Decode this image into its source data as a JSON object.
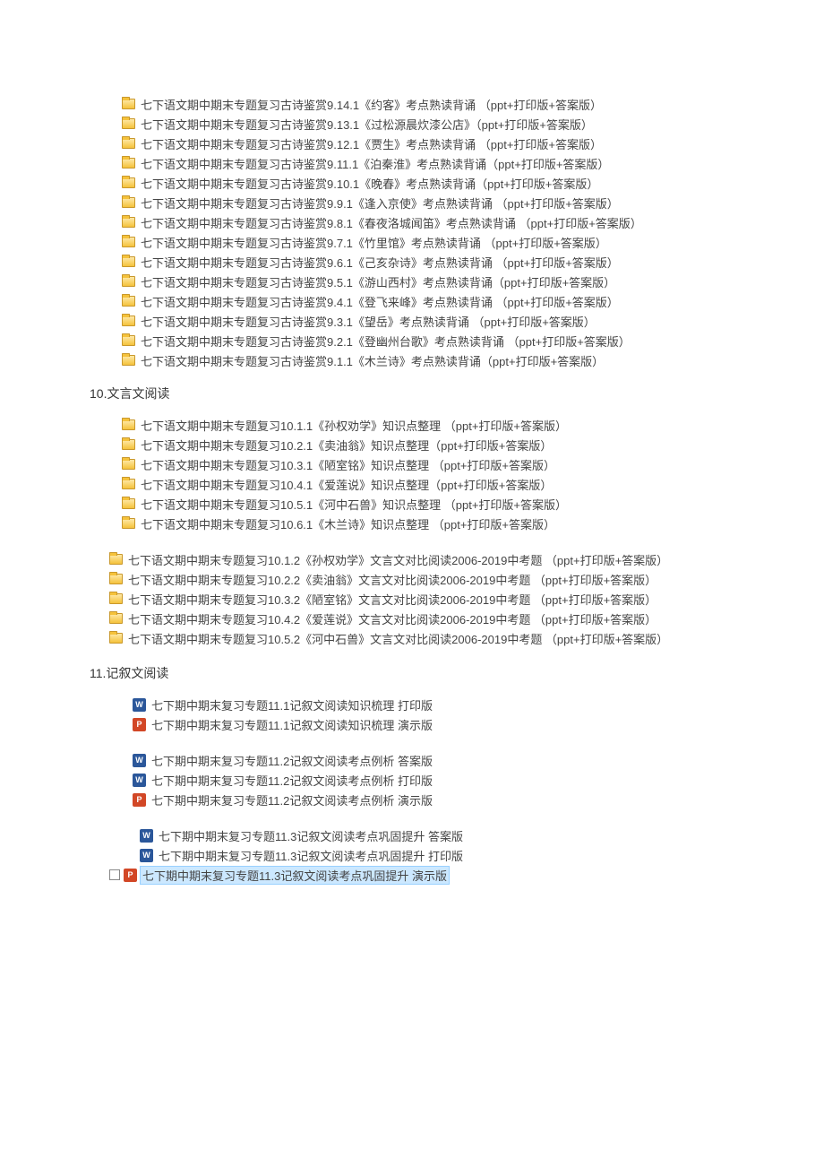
{
  "section9": {
    "items": [
      "七下语文期中期末专题复习古诗鉴赏9.14.1《约客》考点熟读背诵 （ppt+打印版+答案版）",
      "七下语文期中期末专题复习古诗鉴赏9.13.1《过松源晨炊漆公店》（ppt+打印版+答案版）",
      "七下语文期中期末专题复习古诗鉴赏9.12.1《贾生》考点熟读背诵 （ppt+打印版+答案版）",
      "七下语文期中期末专题复习古诗鉴赏9.11.1《泊秦淮》考点熟读背诵（ppt+打印版+答案版）",
      "七下语文期中期末专题复习古诗鉴赏9.10.1《晚春》考点熟读背诵（ppt+打印版+答案版）",
      "七下语文期中期末专题复习古诗鉴赏9.9.1《逢入京使》考点熟读背诵 （ppt+打印版+答案版）",
      "七下语文期中期末专题复习古诗鉴赏9.8.1《春夜洛城闻笛》考点熟读背诵 （ppt+打印版+答案版）",
      "七下语文期中期末专题复习古诗鉴赏9.7.1《竹里馆》考点熟读背诵 （ppt+打印版+答案版）",
      "七下语文期中期末专题复习古诗鉴赏9.6.1《己亥杂诗》考点熟读背诵 （ppt+打印版+答案版）",
      "七下语文期中期末专题复习古诗鉴赏9.5.1《游山西村》考点熟读背诵（ppt+打印版+答案版）",
      "七下语文期中期末专题复习古诗鉴赏9.4.1《登飞来峰》考点熟读背诵 （ppt+打印版+答案版）",
      "七下语文期中期末专题复习古诗鉴赏9.3.1《望岳》考点熟读背诵 （ppt+打印版+答案版）",
      "七下语文期中期末专题复习古诗鉴赏9.2.1《登幽州台歌》考点熟读背诵 （ppt+打印版+答案版）",
      "七下语文期中期末专题复习古诗鉴赏9.1.1《木兰诗》考点熟读背诵（ppt+打印版+答案版）"
    ]
  },
  "heading10": "10.文言文阅读",
  "section10a": {
    "items": [
      "七下语文期中期末专题复习10.1.1《孙权劝学》知识点整理 （ppt+打印版+答案版）",
      "七下语文期中期末专题复习10.2.1《卖油翁》知识点整理（ppt+打印版+答案版）",
      "七下语文期中期末专题复习10.3.1《陋室铭》知识点整理 （ppt+打印版+答案版）",
      "七下语文期中期末专题复习10.4.1《爱莲说》知识点整理（ppt+打印版+答案版）",
      "七下语文期中期末专题复习10.5.1《河中石兽》知识点整理 （ppt+打印版+答案版）",
      "七下语文期中期末专题复习10.6.1《木兰诗》知识点整理 （ppt+打印版+答案版）"
    ]
  },
  "section10b": {
    "items": [
      "七下语文期中期末专题复习10.1.2《孙权劝学》文言文对比阅读2006-2019中考题 （ppt+打印版+答案版）",
      "七下语文期中期末专题复习10.2.2《卖油翁》文言文对比阅读2006-2019中考题 （ppt+打印版+答案版）",
      "七下语文期中期末专题复习10.3.2《陋室铭》文言文对比阅读2006-2019中考题 （ppt+打印版+答案版）",
      "七下语文期中期末专题复习10.4.2《爱莲说》文言文对比阅读2006-2019中考题 （ppt+打印版+答案版）",
      "七下语文期中期末专题复习10.5.2《河中石兽》文言文对比阅读2006-2019中考题 （ppt+打印版+答案版）"
    ]
  },
  "heading11": "11.记叙文阅读",
  "section11a": {
    "items": [
      {
        "type": "word",
        "name": "七下期中期末复习专题11.1记叙文阅读知识梳理 打印版"
      },
      {
        "type": "ppt",
        "name": "七下期中期末复习专题11.1记叙文阅读知识梳理 演示版"
      }
    ]
  },
  "section11b": {
    "items": [
      {
        "type": "word",
        "name": "七下期中期末复习专题11.2记叙文阅读考点例析 答案版"
      },
      {
        "type": "word",
        "name": "七下期中期末复习专题11.2记叙文阅读考点例析 打印版"
      },
      {
        "type": "ppt",
        "name": "七下期中期末复习专题11.2记叙文阅读考点例析 演示版"
      }
    ]
  },
  "section11c": {
    "items": [
      {
        "type": "word",
        "name": "七下期中期末复习专题11.3记叙文阅读考点巩固提升 答案版"
      },
      {
        "type": "word",
        "name": "七下期中期末复习专题11.3记叙文阅读考点巩固提升 打印版"
      },
      {
        "type": "ppt",
        "name": "七下期中期末复习专题11.3记叙文阅读考点巩固提升 演示版",
        "selected": true,
        "checkbox": true
      }
    ]
  },
  "iconGlyph": {
    "word": "W",
    "ppt": "P"
  }
}
